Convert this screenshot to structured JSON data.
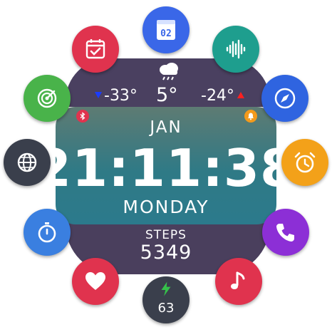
{
  "watchface": {
    "weather": {
      "icon": "rain-cloud-icon",
      "low": "-33°",
      "current": "5°",
      "high": "-24°",
      "low_indicator_color": "#1a3cff",
      "high_indicator_color": "#ff2020"
    },
    "date": {
      "month": "JAN",
      "weekday": "MONDAY"
    },
    "time": "21:11:38",
    "status_icons": {
      "left": "bluetooth-icon",
      "right": "alarm-bell-icon"
    },
    "steps": {
      "label": "STEPS",
      "value": "5349"
    },
    "battery": {
      "icon": "lightning-bolt-icon",
      "value": "63"
    }
  },
  "shortcuts": [
    {
      "name": "date-app",
      "icon": "calendar-date-icon",
      "icon_text": "02",
      "color": "#3a67e8"
    },
    {
      "name": "voice-recorder",
      "icon": "sound-wave-icon",
      "color": "#1e9e8e"
    },
    {
      "name": "compass",
      "icon": "compass-icon",
      "color": "#2f64e0"
    },
    {
      "name": "alarm",
      "icon": "alarm-clock-icon",
      "color": "#f3a119"
    },
    {
      "name": "phone",
      "icon": "phone-icon",
      "color": "#8c2fd6"
    },
    {
      "name": "music",
      "icon": "music-note-icon",
      "color": "#e0334e"
    },
    {
      "name": "heart-rate",
      "icon": "heart-icon",
      "color": "#e0334e"
    },
    {
      "name": "stopwatch",
      "icon": "stopwatch-icon",
      "color": "#3a7fe0"
    },
    {
      "name": "browser",
      "icon": "globe-icon",
      "color": "#3a3f4c"
    },
    {
      "name": "radar",
      "icon": "radar-icon",
      "color": "#49b34a"
    },
    {
      "name": "calendar",
      "icon": "calendar-check-icon",
      "color": "#e0334e"
    }
  ]
}
